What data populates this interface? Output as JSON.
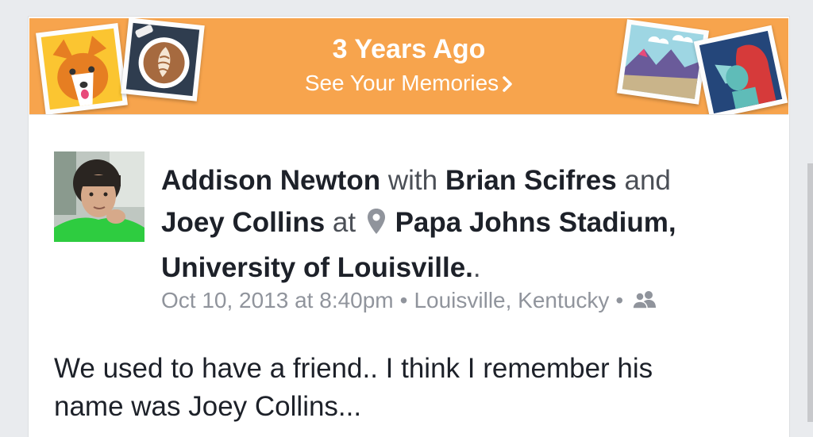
{
  "memories_banner": {
    "title": "3 Years Ago",
    "link_label": "See Your Memories",
    "link_icon": "chevron-right-icon",
    "background_color": "#f7a44d"
  },
  "post": {
    "author": "Addison Newton",
    "with_word": "with",
    "tagged_1": "Brian Scifres",
    "and_word": "and",
    "tagged_2": "Joey Collins",
    "at_word": "at",
    "location_icon": "map-pin-icon",
    "place_name": "Papa Johns Stadium, University of Louisville.",
    "place_suffix": ".",
    "timestamp": "Oct 10, 2013 at 8:40pm",
    "separator": "•",
    "city": "Louisville, Kentucky",
    "audience_icon": "friends-icon",
    "text_line_1": "We used to have a friend.. I think I remember his",
    "text_line_2": "name was Joey Collins..."
  }
}
